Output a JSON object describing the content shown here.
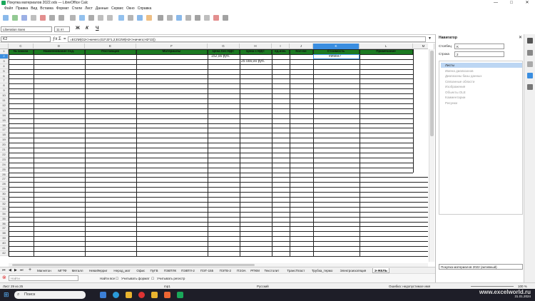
{
  "window": {
    "title": "Покупка материалов 2022.ods — LibreOffice Calc",
    "controls": [
      "—",
      "□",
      "✕"
    ]
  },
  "menu": [
    "Файл",
    "Правка",
    "Вид",
    "Вставка",
    "Формат",
    "Стили",
    "Лист",
    "Данные",
    "Сервис",
    "Окно",
    "Справка"
  ],
  "toolbar2": {
    "font_name": "Liberation Sans",
    "font_size": "11 пт",
    "bold": "Ж",
    "italic": "К",
    "underline": "Ч"
  },
  "formula_bar": {
    "name_box": "K2",
    "func_symbol": "ƒx",
    "sum_symbol": "Σ",
    "eq_symbol": "=",
    "formula": "=ЕСЛИ(G2<>ничего;G2*J2*1,2;ЕСЛИ(H2<>ничего;H2*J2))"
  },
  "columns": [
    {
      "id": "C",
      "sel": false
    },
    {
      "id": "D",
      "sel": false
    },
    {
      "id": "E",
      "sel": false
    },
    {
      "id": "F",
      "sel": false
    },
    {
      "id": "G",
      "sel": false
    },
    {
      "id": "H",
      "sel": false
    },
    {
      "id": "I",
      "sel": false
    },
    {
      "id": "J",
      "sel": false
    },
    {
      "id": "K",
      "sel": true
    },
    {
      "id": "L",
      "sel": false
    },
    {
      "id": "M",
      "sel": false
    }
  ],
  "header_row": [
    "№ заказа",
    "Наименование под.",
    "Поставщик",
    "Материалы",
    "Цена без НДС",
    "Цена с НДС",
    "ед.изм.",
    "Кол-во",
    "Стоимость",
    "Примечание"
  ],
  "cells": {
    "g2": "152,00 руб.",
    "k2": "#ИМЯ?",
    "h3": "25 000,00 руб."
  },
  "row_count": 42,
  "sheet_tabs": [
    "Магнетон",
    "МГТФ",
    "Металл",
    "НеваФерриг",
    "Нерод_мат",
    "Офис",
    "ПуГВ",
    "ПЭВТЛК",
    "ПЭВТЛ-2",
    "ПЭТ-155",
    "ПЭТВ-2",
    "ПЭЭА",
    "РПКМ",
    "Текстолит",
    "ТрансПласт",
    "Трубка_термо",
    "Электроизоляция",
    "Э-ЖЕЛЬ"
  ],
  "find_bar": {
    "placeholder": "Найти",
    "find_all": "Найти все",
    "match_format": "Учитывать формат",
    "match_case": "Учитывать регистр"
  },
  "status_bar": {
    "sheet_info": "Лист 29 из 25",
    "style": "mp1",
    "language": "Русский",
    "error": "Ошибка: недопустимое имя",
    "zoom": "100 %"
  },
  "navigator": {
    "title": "Навигатор",
    "col_label": "Столбец",
    "col_value": "K",
    "row_label": "Строка",
    "row_value": "2",
    "tree": [
      "Листы",
      "Имена диапазонов",
      "Диапазоны базы данных",
      "Связанные области",
      "Изображения",
      "Объекты OLE",
      "Комментарии",
      "Рисунки"
    ],
    "doc_select": "Покупка материалов 2022 (активный)"
  },
  "taskbar": {
    "search": "Поиск",
    "date": "31.01.2024",
    "watermark": "www.excelworld.ru"
  },
  "colors": {
    "header_green": "#1c7a22",
    "selection_blue": "#3b8ee0",
    "taskbar": "#1e1e28"
  }
}
